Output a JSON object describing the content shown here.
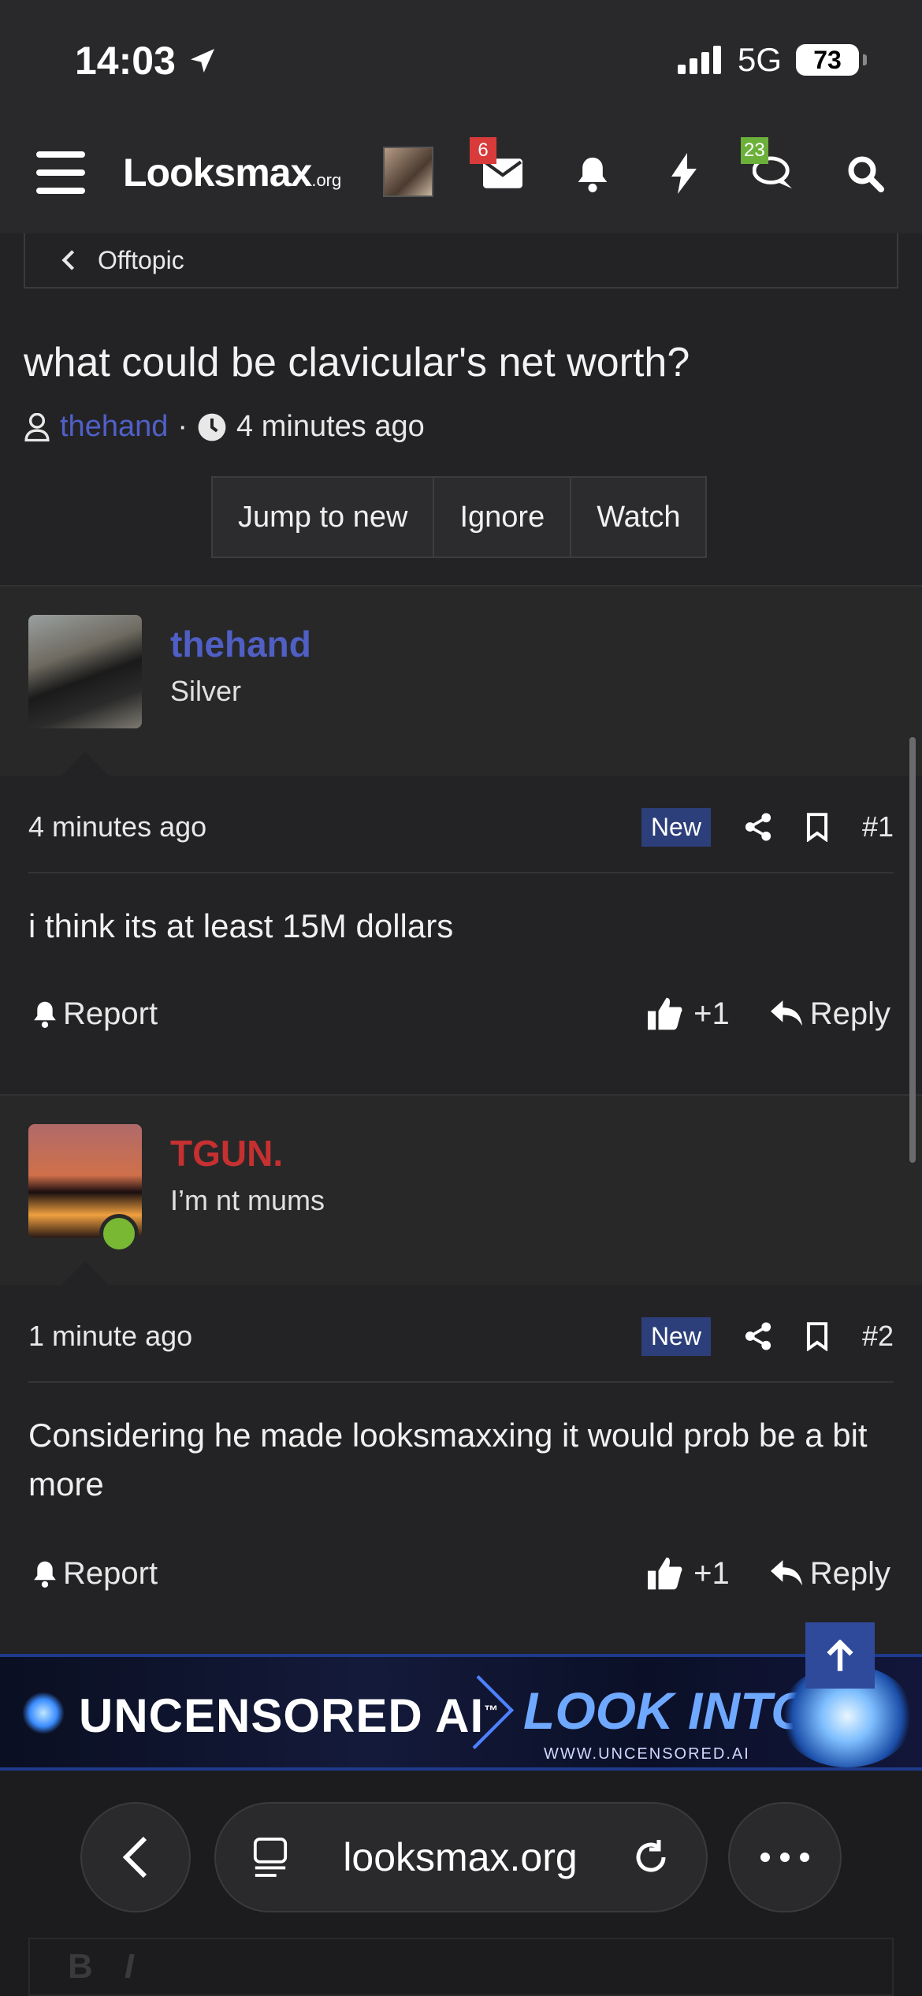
{
  "status": {
    "time": "14:03",
    "network": "5G",
    "battery": "73"
  },
  "header": {
    "logo": "Looksmax",
    "logo_suffix": ".org",
    "badges": {
      "inbox": "6",
      "conversations": "23"
    }
  },
  "breadcrumb": {
    "label": "Offtopic"
  },
  "thread": {
    "title": "what could be clavicular's net worth?",
    "author": "thehand",
    "separator": "·",
    "time": "4 minutes ago",
    "buttons": [
      "Jump to new",
      "Ignore",
      "Watch"
    ]
  },
  "posts": [
    {
      "username": "thehand",
      "user_title": "Silver",
      "time": "4 minutes ago",
      "badge": "New",
      "number": "#1",
      "body": "i think its at least 15M dollars",
      "report": "Report",
      "likes": "+1",
      "reply": "Reply",
      "name_color": "#4f5fc4"
    },
    {
      "username": "TGUN.",
      "user_title": "I’m nt mums",
      "time": "1 minute ago",
      "badge": "New",
      "number": "#2",
      "body": "Considering he made looksmaxxing it would prob be a bit more",
      "report": "Report",
      "likes": "+1",
      "reply": "Reply",
      "name_color": "#c53030"
    }
  ],
  "ad": {
    "left": "UNCENSORED AI",
    "tm": "™",
    "right": "LOOK INTO IT",
    "url": "WWW.UNCENSORED.AI"
  },
  "browser": {
    "url": "looksmax.org"
  },
  "editor": {
    "bold": "B",
    "italic": "I"
  },
  "icons": [
    "location-arrow-icon",
    "signal-icon",
    "battery-icon",
    "hamburger-icon",
    "inbox-icon",
    "bell-icon",
    "bolt-icon",
    "conversations-icon",
    "search-icon",
    "chevron-left-icon",
    "user-icon",
    "clock-icon",
    "share-icon",
    "bookmark-icon",
    "bell-report-icon",
    "thumbs-up-icon",
    "reply-icon",
    "arrow-up-icon",
    "back-icon",
    "reader-icon",
    "reload-icon",
    "more-icon"
  ]
}
